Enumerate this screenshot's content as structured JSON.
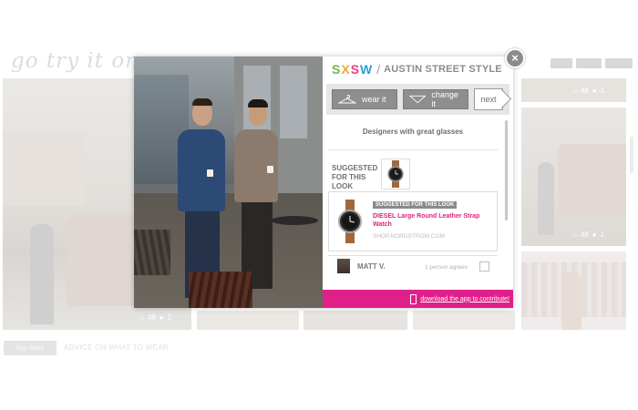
{
  "background": {
    "logo": "go try it on.",
    "stats_left": {
      "likes": "48",
      "comments": "1"
    },
    "stats_right_top": {
      "likes": "48",
      "comments": "1"
    },
    "stats_right_mid": {
      "likes": "48",
      "comments": "1"
    },
    "app_store_badge": "App Store",
    "bottom_tagline": "ADVICE ON WHAT TO WEAR"
  },
  "modal": {
    "close_label": "×",
    "header": {
      "sxsw_letters": [
        "S",
        "X",
        "S",
        "W"
      ],
      "separator": "/",
      "title": "AUSTIN STREET STYLE"
    },
    "actions": {
      "wear_label": "wear it",
      "change_label": "change it",
      "next_label": "next"
    },
    "caption": "Designers with great glasses",
    "suggested_label_line1": "SUGGESTED",
    "suggested_label_line2": "FOR THIS LOOK",
    "suggestion": {
      "badge": "SUGGESTED FOR THIS LOOK",
      "title": "DIESEL Large Round Leather Strap Watch",
      "shop": "SHOP.NORDSTROM.COM"
    },
    "comment": {
      "name": "MATT V.",
      "agree_text": "1 person agrees"
    },
    "footer_link": "download the app to contribute!"
  },
  "colors": {
    "accent_pink": "#e0208a",
    "sxsw_green": "#70b64f",
    "sxsw_orange": "#f0a92f",
    "sxsw_pink": "#e93c7e",
    "sxsw_blue": "#2a9fd6"
  }
}
